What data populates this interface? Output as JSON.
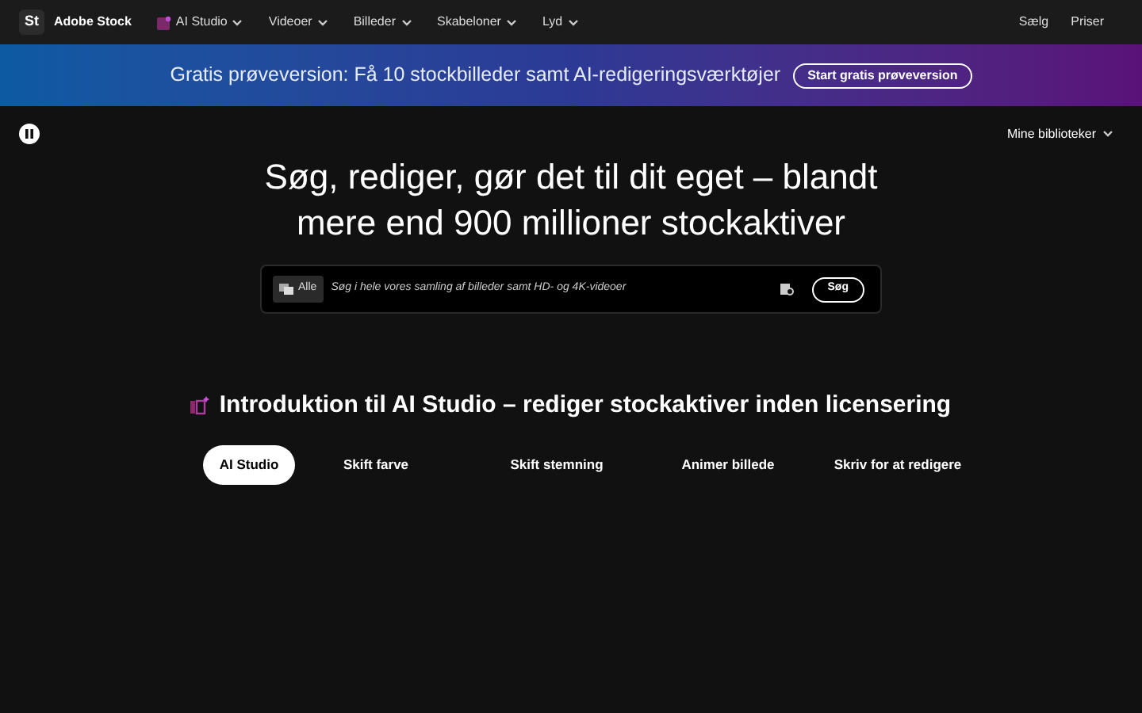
{
  "header": {
    "logo_mark": "St",
    "brand": "Adobe Stock",
    "nav": [
      {
        "label": "AI Studio",
        "kind": "ai"
      },
      {
        "label": "Videoer",
        "kind": "plain"
      },
      {
        "label": "Billeder",
        "kind": "plain"
      },
      {
        "label": "Skabeloner",
        "kind": "plain"
      },
      {
        "label": "Lyd",
        "kind": "plain"
      }
    ],
    "right_links": [
      "Sælg",
      "Priser"
    ]
  },
  "banner": {
    "text": "Gratis prøveversion: Få 10 stockbilleder samt AI-redigeringsværktøjer",
    "button": "Start gratis prøveversion"
  },
  "libraries": "Mine biblioteker",
  "headline": "Søg, rediger, gør det til dit eget – blandt mere end 900 millioner stockaktiver",
  "search": {
    "filter": "Alle",
    "placeholder": "Søg i hele vores samling af billeder samt HD- og 4K-videoer",
    "button": "Søg"
  },
  "section_title": "Introduktion til AI Studio – rediger stockaktiver inden licensering",
  "tabs": [
    {
      "label": "AI Studio",
      "selected": true
    },
    {
      "label": "Skift farve",
      "selected": false
    },
    {
      "label": "Skift stemning",
      "selected": false
    },
    {
      "label": "Animer billede",
      "selected": false
    },
    {
      "label": "Skriv for at redigere",
      "selected": false
    }
  ]
}
